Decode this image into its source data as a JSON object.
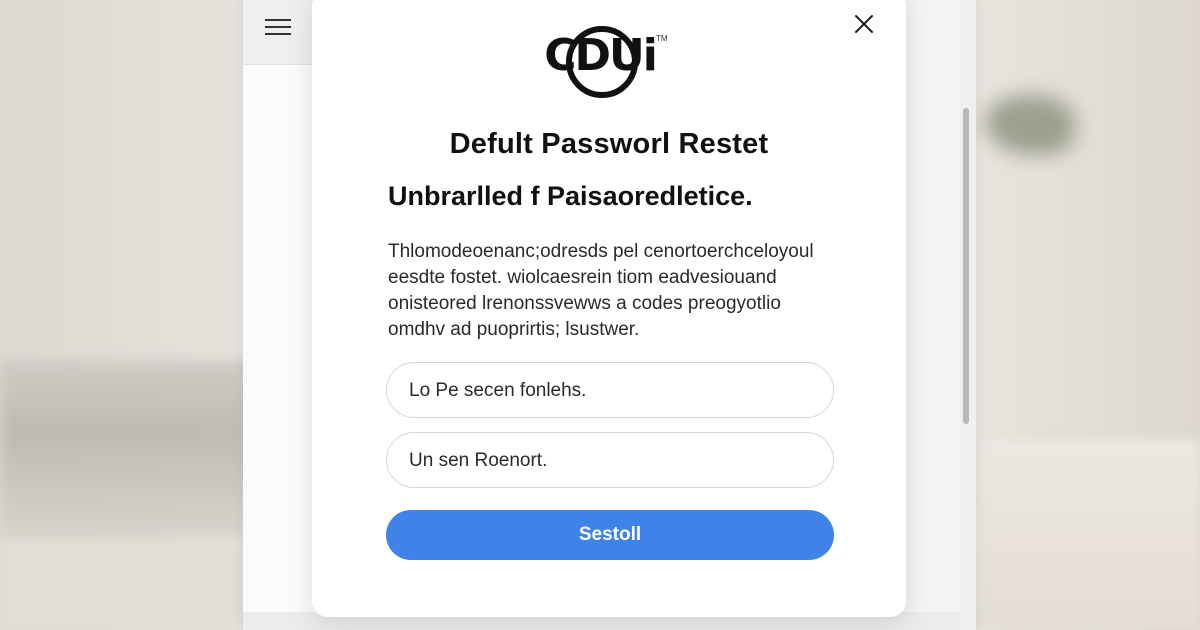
{
  "background": {
    "accent": "#3f82e8"
  },
  "app": {
    "menu_icon": "hamburger-menu-icon"
  },
  "dialog": {
    "close_icon": "close-icon",
    "logo_text": "CDUi",
    "logo_tm": "TM",
    "title": "Defult Passworl Restet",
    "subtitle": "Unbrarlled f Paisaoredletice.",
    "body_lines": [
      "Thlomodeoenanc;odresds pel cenortoerchceloyoul",
      "eesdte fostet. wiolcaesrein tiom eadvesiouand",
      "onisteored lrenonssvewws a codes preogyotlio",
      "omdhv ad puoprirtis; lsustwer."
    ],
    "field1_value": "Lo Pe secen fonlehs.",
    "field2_value": "Un sen  Roenort.",
    "submit_label": "Sestoll"
  }
}
